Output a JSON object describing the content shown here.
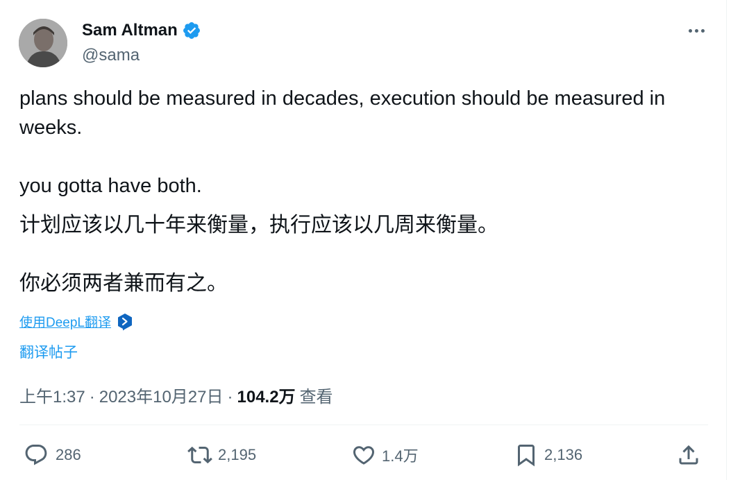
{
  "author": {
    "display_name": "Sam Altman",
    "handle": "@sama",
    "verified": true,
    "avatar_icon": "avatar-photo"
  },
  "tweet": {
    "paragraphs": [
      "plans should be measured in decades, execution should be measured in weeks.",
      "you gotta have both."
    ]
  },
  "translation": {
    "paragraphs": [
      "计划应该以几十年来衡量，执行应该以几周来衡量。",
      "你必须两者兼而有之。"
    ],
    "deepl_label": "使用DeepL翻译",
    "translate_post_label": "翻译帖子"
  },
  "meta": {
    "time": "上午1:37",
    "separator": "·",
    "date": "2023年10月27日",
    "views": "104.2万",
    "views_label": "查看"
  },
  "actions": {
    "replies": "286",
    "reposts": "2,195",
    "likes": "1.4万",
    "bookmarks": "2,136"
  },
  "colors": {
    "accent": "#1d9bf0",
    "text": "#0f1419",
    "muted": "#536471",
    "border": "#eff3f4"
  }
}
